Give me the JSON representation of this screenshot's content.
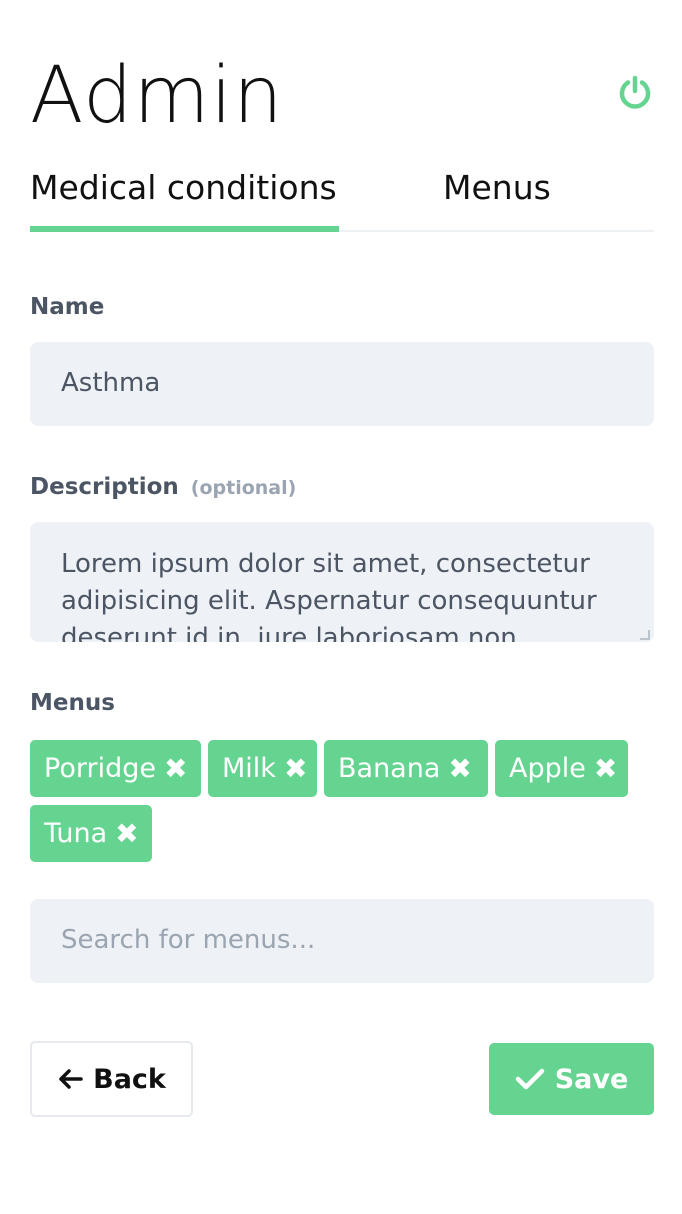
{
  "header": {
    "title": "Admin",
    "power_icon": "power-icon"
  },
  "tabs": [
    {
      "label": "Medical conditions",
      "active": true
    },
    {
      "label": "Menus",
      "active": false
    }
  ],
  "form": {
    "name_label": "Name",
    "name_value": "Asthma",
    "description_label": "Description",
    "description_optional": "(optional)",
    "description_value": "Lorem ipsum dolor sit amet, consectetur adipisicing elit. Aspernatur consequuntur deserunt id in, iure laboriosam non",
    "menus_label": "Menus",
    "menus": [
      {
        "label": "Porridge",
        "remove_icon": "close-icon"
      },
      {
        "label": "Milk",
        "remove_icon": "close-icon"
      },
      {
        "label": "Banana",
        "remove_icon": "close-icon"
      },
      {
        "label": "Apple",
        "remove_icon": "close-icon"
      },
      {
        "label": "Tuna",
        "remove_icon": "close-icon"
      }
    ],
    "search_placeholder": "Search for menus..."
  },
  "actions": {
    "back_label": "Back",
    "save_label": "Save"
  },
  "colors": {
    "accent": "#66d491",
    "field_bg": "#eef1f5",
    "label": "#4b5563",
    "muted": "#9aa5b1"
  }
}
